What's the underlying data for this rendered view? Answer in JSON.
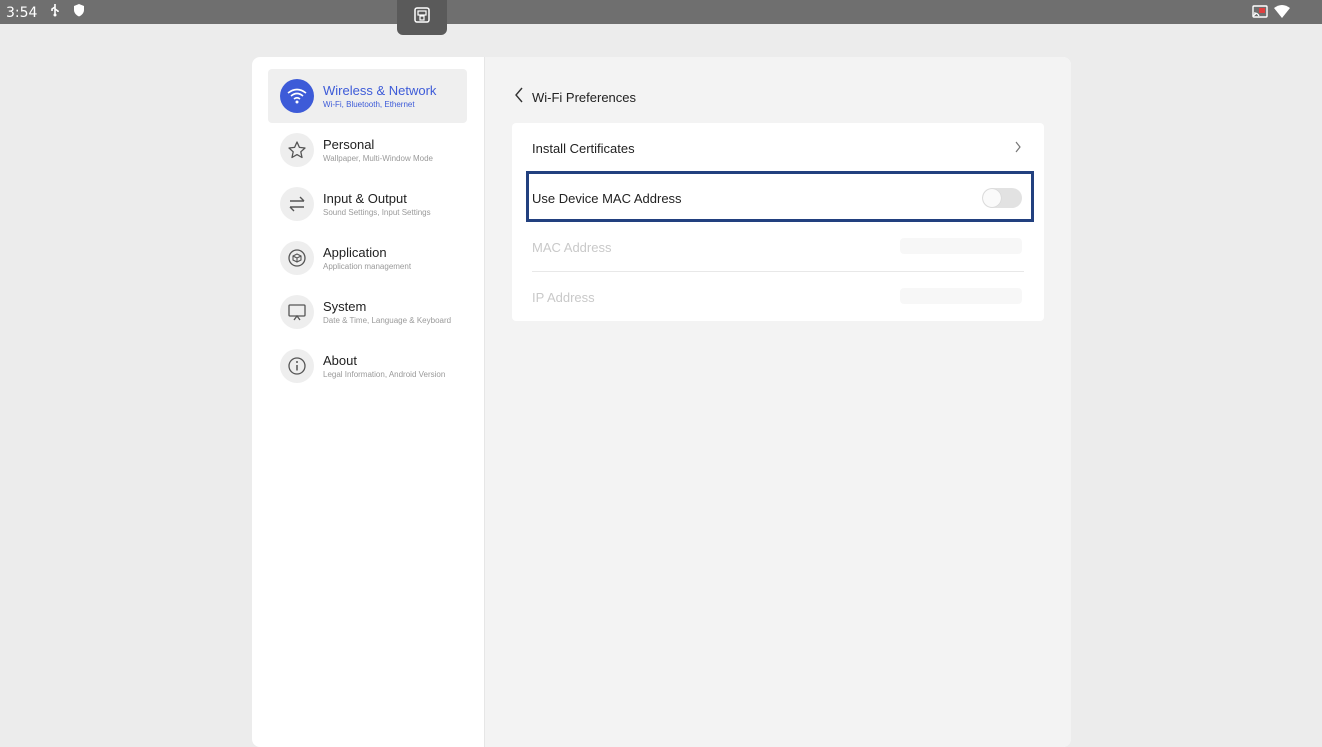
{
  "status_bar": {
    "time": "3:54",
    "left_icons": [
      "usb-icon",
      "shield-icon"
    ],
    "right_icons": [
      "cast-icon",
      "wifi-icon"
    ]
  },
  "sidebar": {
    "items": [
      {
        "title": "Wireless & Network",
        "subtitle": "Wi-Fi, Bluetooth, Ethernet",
        "icon": "wifi-icon",
        "active": true
      },
      {
        "title": "Personal",
        "subtitle": "Wallpaper, Multi-Window Mode",
        "icon": "star-icon",
        "active": false
      },
      {
        "title": "Input & Output",
        "subtitle": "Sound Settings, Input Settings",
        "icon": "swap-arrows-icon",
        "active": false
      },
      {
        "title": "Application",
        "subtitle": "Application management",
        "icon": "cube-icon",
        "active": false
      },
      {
        "title": "System",
        "subtitle": "Date & Time, Language & Keyboard",
        "icon": "monitor-icon",
        "active": false
      },
      {
        "title": "About",
        "subtitle": "Legal Information, Android Version",
        "icon": "info-icon",
        "active": false
      }
    ]
  },
  "content": {
    "page_title": "Wi-Fi Preferences",
    "rows": [
      {
        "label": "Install Certificates",
        "type": "link"
      },
      {
        "label": "Use Device MAC Address",
        "type": "toggle",
        "value": false
      },
      {
        "label": "MAC Address",
        "type": "value",
        "disabled": true
      },
      {
        "label": "IP Address",
        "type": "value",
        "disabled": true
      }
    ]
  },
  "colors": {
    "accent": "#3d5bd8",
    "highlight_border": "#22407f",
    "status_bar": "#6f6f6f"
  }
}
